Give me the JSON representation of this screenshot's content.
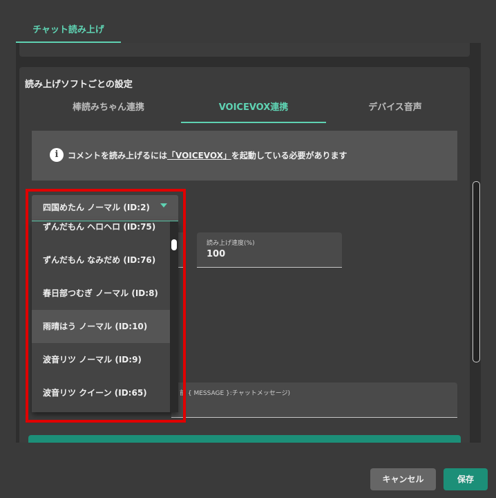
{
  "tabs": {
    "active_label": "チャット読み上げ"
  },
  "settings": {
    "title": "読み上げソフトごとの設定",
    "sub_tabs": [
      "棒読みちゃん連携",
      "VOICEVOX連携",
      "デバイス音声"
    ],
    "active_sub_tab": "VOICEVOX連携",
    "info": {
      "before": "コメントを読み上げるには",
      "link": "「VOICEVOX」",
      "after": "を起動している必要があります"
    },
    "speed": {
      "label": "読み上げ速度(%)",
      "value": "100"
    },
    "template_hint": "{ MESSAGE }:チャットメッセージ)",
    "template_hint_prefix": "前"
  },
  "speaker_select": {
    "value": "四国めたん ノーマル (ID:2)",
    "options": [
      "ずんだもん ヘロヘロ (ID:75)",
      "ずんだもん なみだめ (ID:76)",
      "春日部つむぎ ノーマル (ID:8)",
      "雨晴はう ノーマル (ID:10)",
      "波音リツ ノーマル (ID:9)",
      "波音リツ クイーン (ID:65)"
    ],
    "hovered_index": 3
  },
  "footer": {
    "cancel_label": "キャンセル",
    "save_label": "保存"
  },
  "colors": {
    "accent": "#5fd3b3",
    "primary": "#1c8f78",
    "highlight": "#e00000"
  }
}
